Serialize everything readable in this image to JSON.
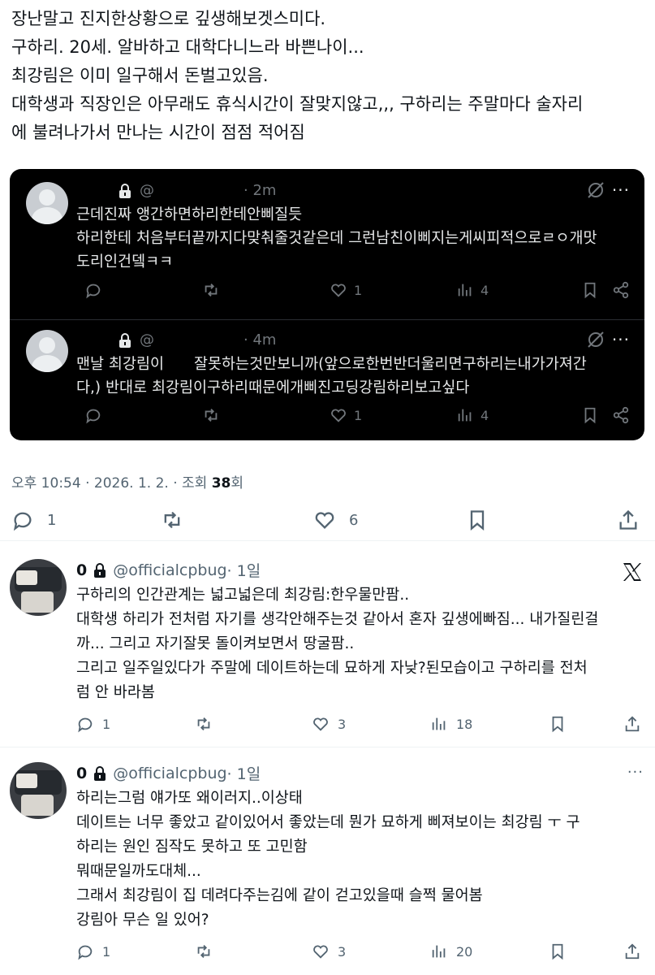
{
  "post": {
    "lines": [
      "장난말고 진지한상황으로 깊생해보겟스미다.",
      "구하리. 20세. 알바하고 대학다니느라 바쁜나이...",
      "최강림은 이미 일구해서 돈벌고있음.",
      "대학생과 직장인은 아무래도 휴식시간이 잘맞지않고,,, 구하리는 주말마다 술자리",
      "에 불려나가서 만나는 시간이 점점 적어짐"
    ],
    "timestamp": "오후 10:54 · 2026. 1. 2. · 조회 ",
    "views": "38",
    "views_suffix": "회",
    "reply_count": "1",
    "like_count": "6"
  },
  "quoted": [
    {
      "handle_prefix": "@",
      "time": "· 2m",
      "lines": [
        "근데진짜 앵간하면하리한테안삐질듯",
        "하리한테 처음부터끝까지다맞춰줄것같은데 그런남친이삐지는게씨피적으로ㄹㅇ개맛",
        "도리인건뎈ㅋㅋ"
      ],
      "likes": "1",
      "views": "4"
    },
    {
      "handle_prefix": "@",
      "time": "· 4m",
      "lines": [
        "맨날 최강림이　　잘못하는것만보니까(앞으로한번반더울리면구하리는내가가져간",
        "다,) 반대로 최강림이구하리때문에개삐진고딩강림하리보고싶다"
      ],
      "likes": "1",
      "views": "4"
    }
  ],
  "replies": [
    {
      "name": "0",
      "handle": "@officialcpbug",
      "time": "· 1일",
      "lines": [
        "구하리의 인간관계는 넓고넓은데 최강림:한우물만팜..",
        "대학생 하리가 전처럼 자기를 생각안해주는것 같아서 혼자 깊생에빠짐... 내가질린걸",
        "까... 그리고 자기잘못 돌이켜보면서 땅굴팜..",
        "그리고 일주일있다가 주말에 데이트하는데 묘하게 자낮?된모습이고 구하리를 전처",
        "럼 안 바라봄"
      ],
      "replies": "1",
      "reposts": "",
      "likes": "3",
      "views": "18"
    },
    {
      "name": "0",
      "handle": "@officialcpbug",
      "time": "· 1일",
      "lines": [
        "하리는그럼 얘가또 왜이러지..이상태",
        "데이트는 너무 좋았고 같이있어서 좋았는데 뭔가 묘하게 삐져보이는 최강림 ㅜ 구",
        "하리는 원인 짐작도 못하고 또 고민함",
        "뭐때문일까도대체...",
        "그래서 최강림이 집 데려다주는김에 같이 걷고있을때 슬쩍 물어봄",
        "강림아 무슨 일 있어?"
      ],
      "replies": "1",
      "reposts": "",
      "likes": "3",
      "views": "20"
    }
  ],
  "colors": {
    "text": "#0f1419",
    "muted": "#536471",
    "quote_bg": "#000000",
    "quote_text": "#e7e9ea",
    "quote_muted": "#71767b"
  },
  "icons": [
    "lock-icon",
    "grok-icon",
    "more-icon",
    "reply-icon",
    "repost-icon",
    "like-icon",
    "views-icon",
    "bookmark-icon",
    "share-icon",
    "upload-icon",
    "x-logo-icon"
  ]
}
